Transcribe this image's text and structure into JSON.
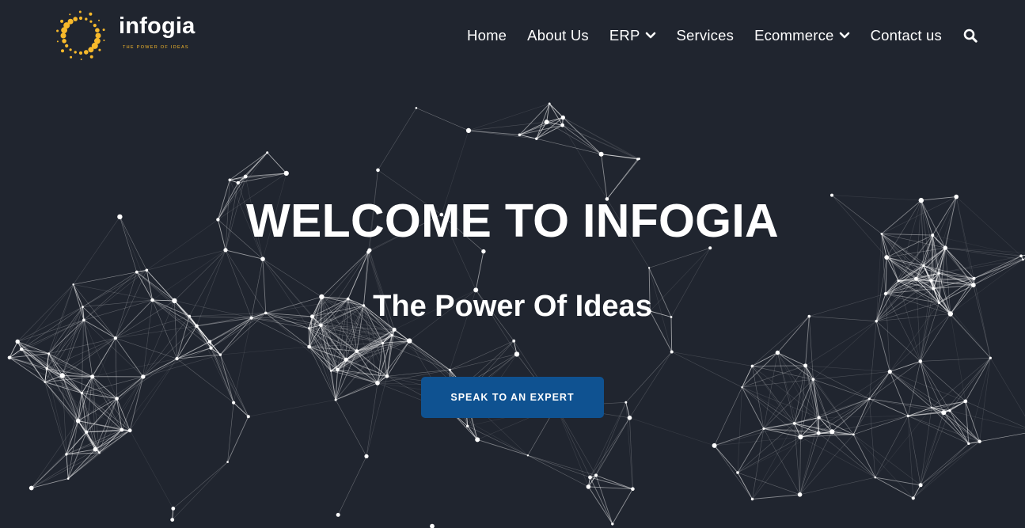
{
  "brand": {
    "name": "infogia",
    "tagline": "THE POWER OF IDEAS",
    "logo_icon": "dotted-ring-logo",
    "accent_color": "#f7b92b"
  },
  "nav": {
    "items": [
      {
        "label": "Home",
        "has_dropdown": false
      },
      {
        "label": "About Us",
        "has_dropdown": false
      },
      {
        "label": "ERP",
        "has_dropdown": true
      },
      {
        "label": "Services",
        "has_dropdown": false
      },
      {
        "label": "Ecommerce",
        "has_dropdown": true
      },
      {
        "label": "Contact us",
        "has_dropdown": false
      }
    ],
    "search_icon": "search-icon"
  },
  "hero": {
    "title": "WELCOME TO INFOGIA",
    "subtitle": "The Power Of Ideas",
    "cta_label": "SPEAK TO AN EXPERT",
    "cta_color": "#0f5291",
    "background_color": "#20252f",
    "background_pattern": "connected-node-network"
  }
}
